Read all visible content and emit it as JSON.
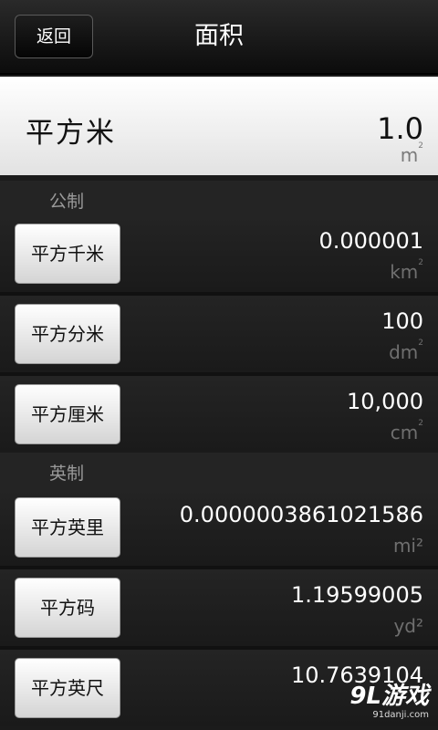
{
  "header": {
    "back_label": "返回",
    "title": "面积"
  },
  "selected": {
    "name": "平方米",
    "value": "1.0",
    "unit": "m",
    "unit_sup": "2"
  },
  "sections": [
    {
      "label": "公制"
    },
    {
      "label": "英制"
    }
  ],
  "rows": [
    {
      "label": "平方千米",
      "value": "0.000001",
      "unit": "km",
      "unit_sup": "2"
    },
    {
      "label": "平方分米",
      "value": "100",
      "unit": "dm",
      "unit_sup": "2"
    },
    {
      "label": "平方厘米",
      "value": "10,000",
      "unit": "cm",
      "unit_sup": "2"
    },
    {
      "label": "平方英里",
      "value": "0.0000003861021586",
      "unit": "mi²",
      "unit_sup": ""
    },
    {
      "label": "平方码",
      "value": "1.19599005",
      "unit": "yd²",
      "unit_sup": ""
    },
    {
      "label": "平方英尺",
      "value": "10.7639104",
      "unit": "",
      "unit_sup": ""
    }
  ],
  "watermark": {
    "logo": "9L游戏",
    "url": "91danji.com"
  }
}
